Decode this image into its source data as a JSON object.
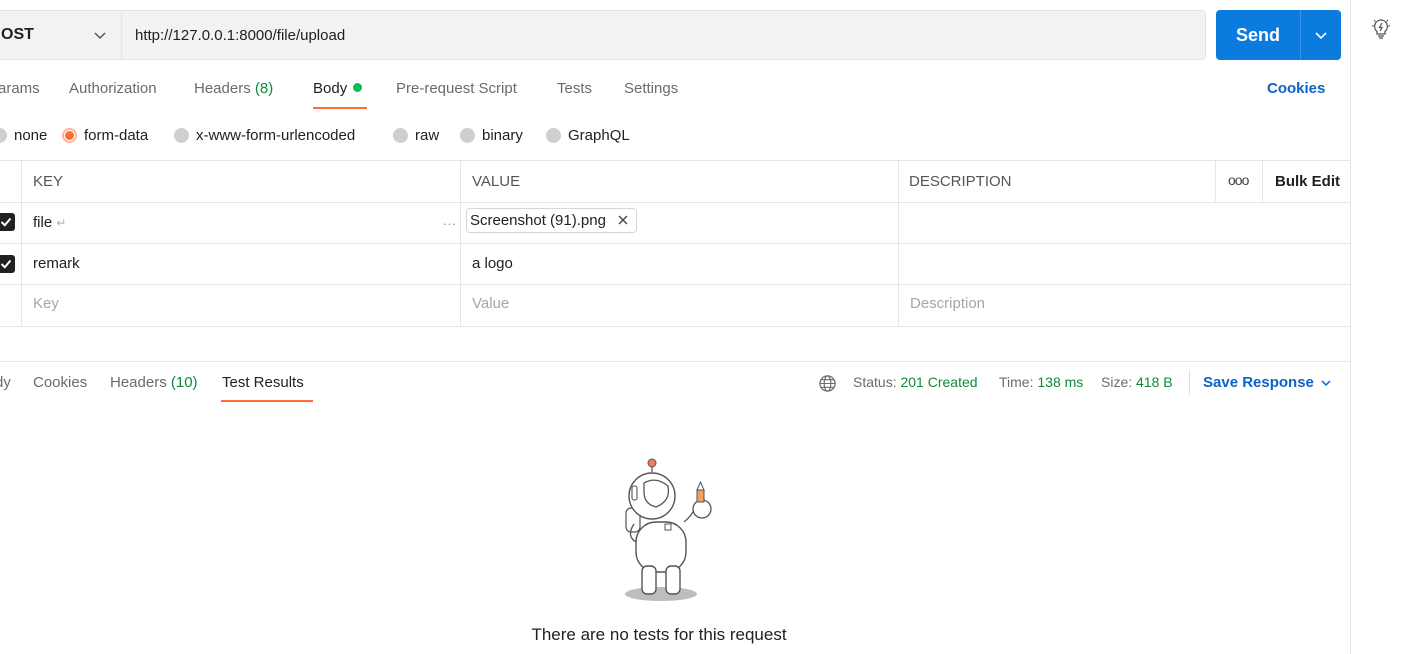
{
  "request": {
    "method": "POST",
    "method_visible": "OST",
    "url": "http://127.0.0.1:8000/file/upload",
    "send_label": "Send"
  },
  "request_tabs": {
    "params": "arams",
    "authorization": "Authorization",
    "headers": "Headers",
    "headers_count": "(8)",
    "body": "Body",
    "prerequest": "Pre-request Script",
    "tests": "Tests",
    "settings": "Settings",
    "cookies": "Cookies"
  },
  "body_types": {
    "none": "none",
    "form_data": "form-data",
    "urlencoded": "x-www-form-urlencoded",
    "raw": "raw",
    "binary": "binary",
    "graphql": "GraphQL",
    "selected": "form-data"
  },
  "table": {
    "headers": {
      "key": "KEY",
      "value": "VALUE",
      "description": "DESCRIPTION",
      "bulk_edit": "Bulk Edit",
      "more": "ooo"
    },
    "rows": [
      {
        "key": "file",
        "value": "Screenshot (91).png",
        "description": "",
        "checked": true
      },
      {
        "key": "remark",
        "value": "a logo",
        "description": "",
        "checked": true
      }
    ],
    "placeholders": {
      "key": "Key",
      "value": "Value",
      "description": "Description"
    }
  },
  "response": {
    "tabs": {
      "body": "dy",
      "cookies": "Cookies",
      "headers": "Headers",
      "headers_count": "(10)",
      "test_results": "Test Results"
    },
    "status_label": "Status:",
    "status_value": "201 Created",
    "time_label": "Time:",
    "time_value": "138 ms",
    "size_label": "Size:",
    "size_value": "418 B",
    "save_response": "Save Response",
    "empty_message": "There are no tests for this request"
  },
  "colors": {
    "accent": "#ff6c37",
    "send": "#0c7bde",
    "link": "#0b63c9",
    "success": "#0f8a3a",
    "dot": "#0cbb52"
  }
}
